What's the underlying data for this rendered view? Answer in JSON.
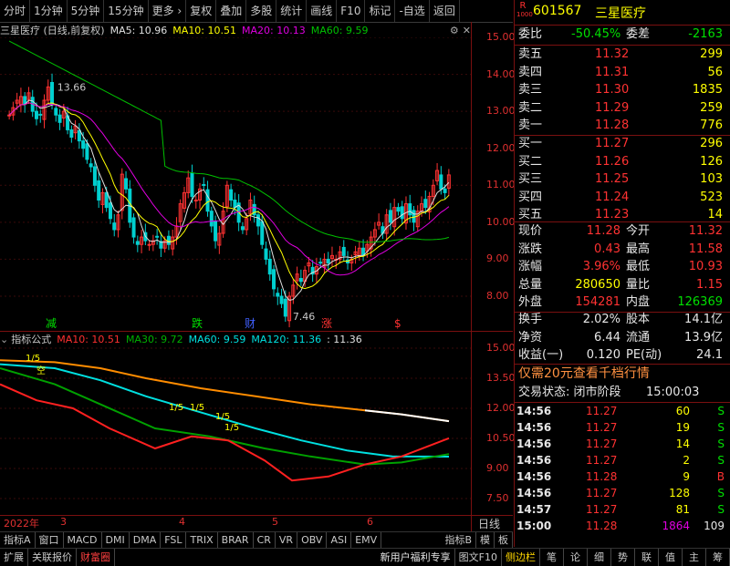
{
  "toolbar": {
    "items": [
      "分时",
      "1分钟",
      "5分钟",
      "15分钟",
      "更多 ›",
      "复权",
      "叠加",
      "多股",
      "统计",
      "画线",
      "F10",
      "标记",
      "-自选",
      "返回"
    ]
  },
  "chart": {
    "title": "三星医疗 (日线,前复权)",
    "ma5": "MA5: 10.96",
    "ma10": "MA10: 10.51",
    "ma20": "MA20: 10.13",
    "ma60": "MA60: 9.59",
    "high_label": "13.66",
    "low_label": "7.46",
    "y_ticks": [
      "15.00",
      "14.00",
      "13.00",
      "12.00",
      "11.00",
      "10.00",
      "9.00",
      "8.00"
    ],
    "signals": [
      "减",
      "跌",
      "财",
      "涨",
      "$"
    ],
    "colors": {
      "up": "#ff3232",
      "down": "#00d0d0",
      "ma5": "#e0e0e0",
      "ma10": "#ffff00",
      "ma20": "#e000e0",
      "ma60": "#00c000"
    }
  },
  "indicator": {
    "name": "指标公式",
    "ma10": "MA10: 10.51",
    "ma30": "MA30: 9.72",
    "ma60": "MA60: 9.59",
    "ma120": "MA120: 11.36",
    "extra": ": 11.36",
    "y_ticks": [
      "15.00",
      "13.50",
      "12.00",
      "10.50",
      "9.00",
      "7.50"
    ],
    "marks": [
      "1/5",
      "空",
      "1/5",
      "1/5",
      "1/5",
      "1/5"
    ]
  },
  "time_axis": {
    "labels": [
      "2022年",
      "3",
      "4",
      "5",
      "6"
    ],
    "period": "日线"
  },
  "bottom_tabs": [
    "指标A",
    "窗口",
    "MACD",
    "DMI",
    "DMA",
    "FSL",
    "TRIX",
    "BRAR",
    "CR",
    "VR",
    "OBV",
    "ASI",
    "EMV",
    "指标B",
    "模",
    "板"
  ],
  "status_bar": {
    "left": [
      "扩展",
      "关联报价",
      "财富圈"
    ],
    "promo": "新用户福利专享",
    "f10": "图文F10",
    "side": "侧边栏",
    "right_icons": [
      "笔",
      "论",
      "细",
      "势",
      "联",
      "值",
      "主",
      "筹"
    ]
  },
  "quote": {
    "code": "601567",
    "name": "三星医疗",
    "badge": "R",
    "badge_sub": "1000",
    "weibi_label": "委比",
    "weibi": "-50.45%",
    "weicha_label": "委差",
    "weicha": "-2163",
    "asks": [
      {
        "label": "卖五",
        "price": "11.32",
        "vol": "299"
      },
      {
        "label": "卖四",
        "price": "11.31",
        "vol": "56"
      },
      {
        "label": "卖三",
        "price": "11.30",
        "vol": "1835"
      },
      {
        "label": "卖二",
        "price": "11.29",
        "vol": "259"
      },
      {
        "label": "卖一",
        "price": "11.28",
        "vol": "776"
      }
    ],
    "bids": [
      {
        "label": "买一",
        "price": "11.27",
        "vol": "296"
      },
      {
        "label": "买二",
        "price": "11.26",
        "vol": "126"
      },
      {
        "label": "买三",
        "price": "11.25",
        "vol": "103"
      },
      {
        "label": "买四",
        "price": "11.24",
        "vol": "523"
      },
      {
        "label": "买五",
        "price": "11.23",
        "vol": "14"
      }
    ],
    "stats": [
      {
        "l1": "现价",
        "v1": "11.28",
        "l2": "今开",
        "v2": "11.32"
      },
      {
        "l1": "涨跌",
        "v1": "0.43",
        "l2": "最高",
        "v2": "11.58"
      },
      {
        "l1": "涨幅",
        "v1": "3.96%",
        "l2": "最低",
        "v2": "10.93"
      },
      {
        "l1": "总量",
        "v1": "280650",
        "l2": "量比",
        "v2": "1.15"
      },
      {
        "l1": "外盘",
        "v1": "154281",
        "l2": "内盘",
        "v2": "126369"
      }
    ],
    "stats2": [
      {
        "l1": "换手",
        "v1": "2.02%",
        "l2": "股本",
        "v2": "14.1亿"
      },
      {
        "l1": "净资",
        "v1": "6.44",
        "l2": "流通",
        "v2": "13.9亿"
      },
      {
        "l1": "收益(一)",
        "v1": "0.120",
        "l2": "PE(动)",
        "v2": "24.1"
      }
    ],
    "promo": "仅需20元查看千档行情",
    "trade_state_label": "交易状态:",
    "trade_state": "闭市阶段",
    "trade_time": "15:00:03",
    "ticks": [
      {
        "t": "14:56",
        "p": "11.27",
        "v": "60",
        "s": "S"
      },
      {
        "t": "14:56",
        "p": "11.27",
        "v": "19",
        "s": "S"
      },
      {
        "t": "14:56",
        "p": "11.27",
        "v": "14",
        "s": "S"
      },
      {
        "t": "14:56",
        "p": "11.27",
        "v": "2",
        "s": "S"
      },
      {
        "t": "14:56",
        "p": "11.28",
        "v": "9",
        "s": "B"
      },
      {
        "t": "14:56",
        "p": "11.27",
        "v": "128",
        "s": "S"
      },
      {
        "t": "14:57",
        "p": "11.27",
        "v": "81",
        "s": "S"
      },
      {
        "t": "15:00",
        "p": "11.28",
        "v": "1864",
        "s": "109"
      }
    ]
  }
}
